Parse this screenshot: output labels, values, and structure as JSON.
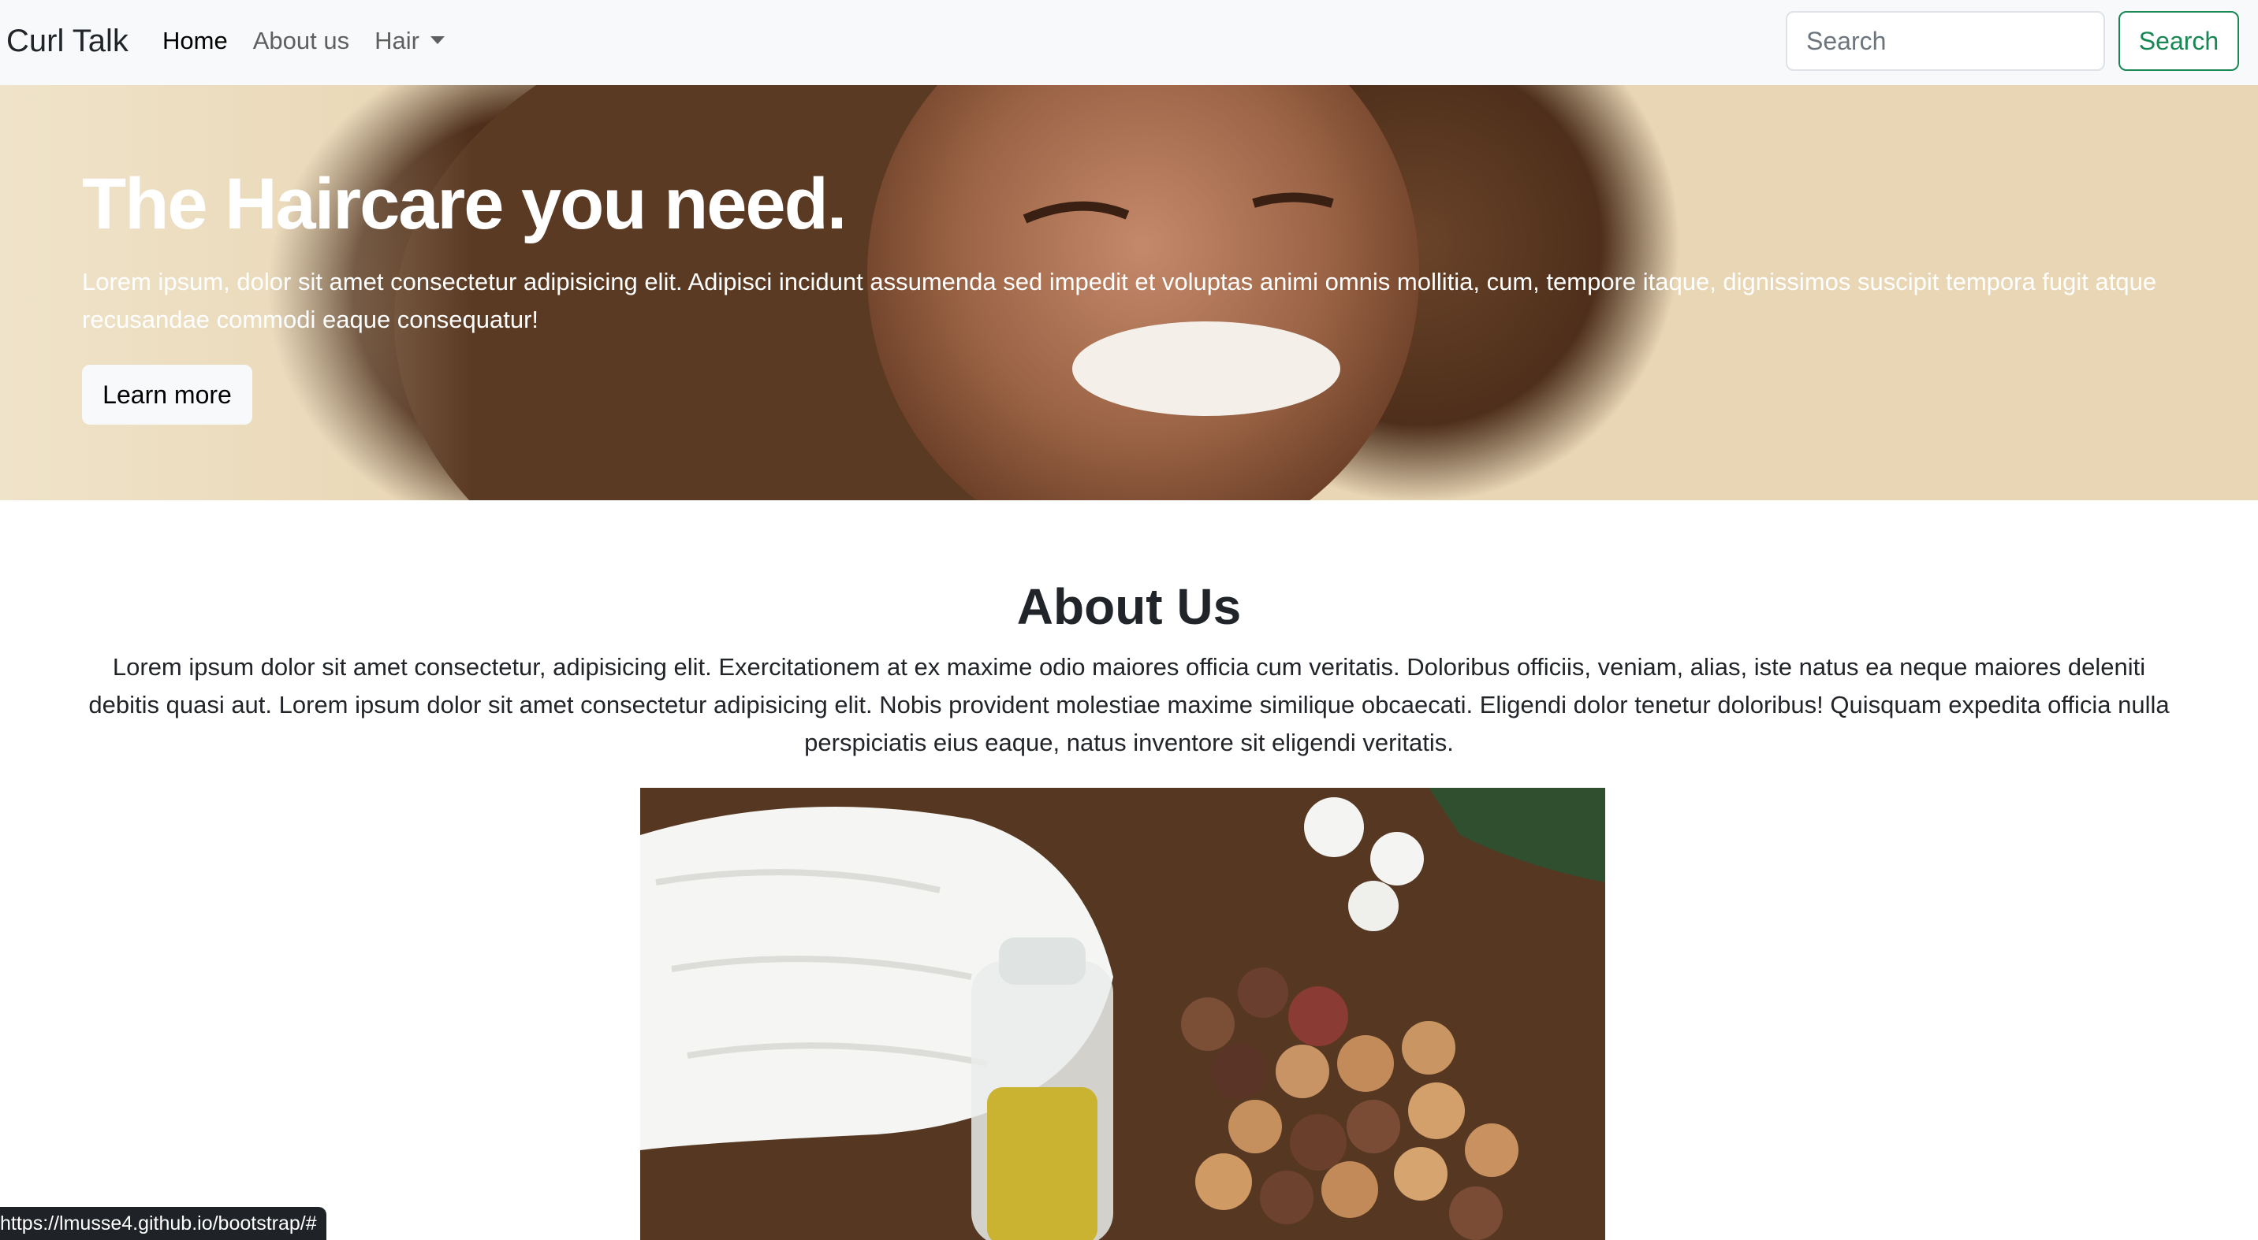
{
  "navbar": {
    "brand": "Curl Talk",
    "links": [
      {
        "label": "Home"
      },
      {
        "label": "About us"
      },
      {
        "label": "Hair"
      }
    ],
    "search_placeholder": "Search",
    "search_button": "Search"
  },
  "hero": {
    "title": "The Haircare you need.",
    "text": "Lorem ipsum, dolor sit amet consectetur adipisicing elit. Adipisci incidunt assumenda sed impedit et voluptas animi omnis mollitia, cum, tempore itaque, dignissimos suscipit tempora fugit atque recusandae commodi eaque consequatur!",
    "button": "Learn more"
  },
  "about": {
    "title": "About Us",
    "text": "Lorem ipsum dolor sit amet consectetur, adipisicing elit. Exercitationem at ex maxime odio maiores officia cum veritatis. Doloribus officiis, veniam, alias, iste natus ea neque maiores deleniti debitis quasi aut. Lorem ipsum dolor sit amet consectetur adipisicing elit. Nobis provident molestiae maxime similique obcaecati. Eligendi dolor tenetur doloribus! Quisquam expedita officia nulla perspiciatis eius eaque, natus inventore sit eligendi veritatis."
  },
  "status_bar": {
    "url": "https://lmusse4.github.io/bootstrap/#"
  },
  "colors": {
    "navbar_bg": "#f8f9fa",
    "success": "#198754",
    "text": "#212529",
    "muted_link": "#6c757d"
  },
  "icons": {
    "dropdown": "caret-down-icon"
  }
}
